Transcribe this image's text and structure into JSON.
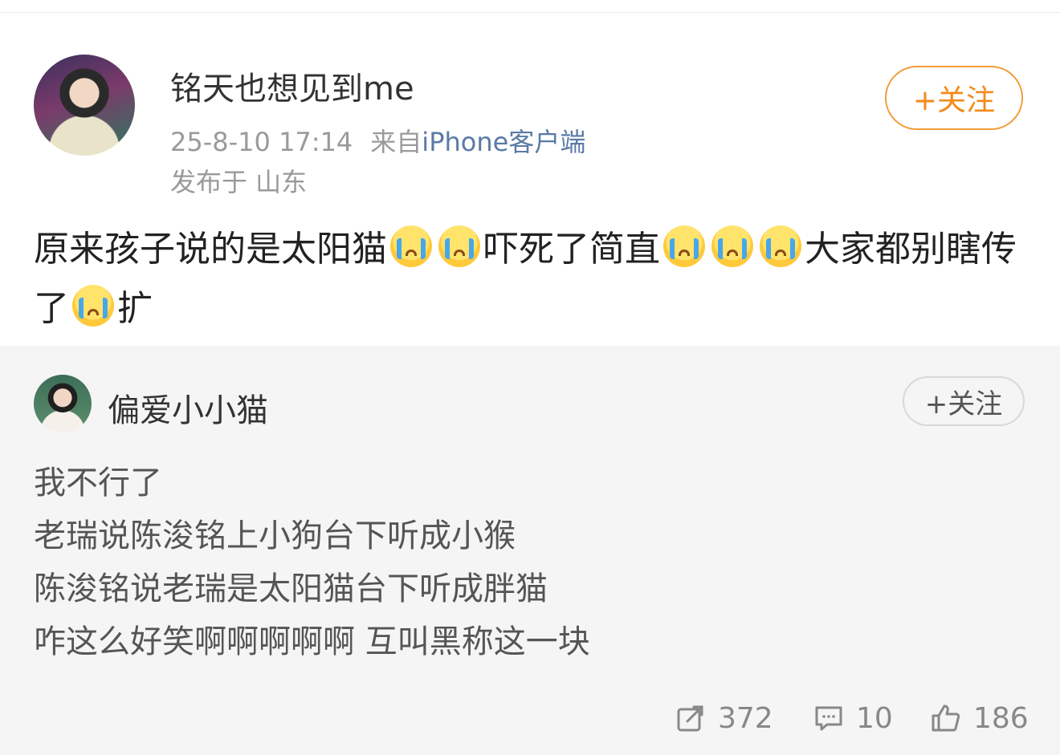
{
  "post": {
    "username": "铭天也想见到me",
    "timestamp": "25-8-10 17:14",
    "from_prefix": "来自",
    "source": "iPhone客户端",
    "location": "发布于 山东",
    "follow_label": "+关注",
    "text_segments": [
      "原来孩子说的是太阳猫",
      "吓死了简直",
      "大家都别瞎传了",
      "扩"
    ],
    "emoji_name": "crying-face-emoji"
  },
  "repost": {
    "username": "偏爱小小猫",
    "follow_label": "+关注",
    "lines": [
      "我不行了",
      "老瑞说陈浚铭上小狗台下听成小猴",
      "陈浚铭说老瑞是太阳猫台下听成胖猫",
      "咋这么好笑啊啊啊啊啊 互叫黑称这一块"
    ]
  },
  "actions": {
    "reposts": "372",
    "comments": "10",
    "likes": "186",
    "icons": [
      "repost-icon",
      "comment-icon",
      "like-icon"
    ]
  },
  "colors": {
    "accent_orange": "#f28a1a",
    "source_blue": "#5a7aa6",
    "meta_gray": "#9a9a9a",
    "repost_background": "#f5f5f5"
  }
}
